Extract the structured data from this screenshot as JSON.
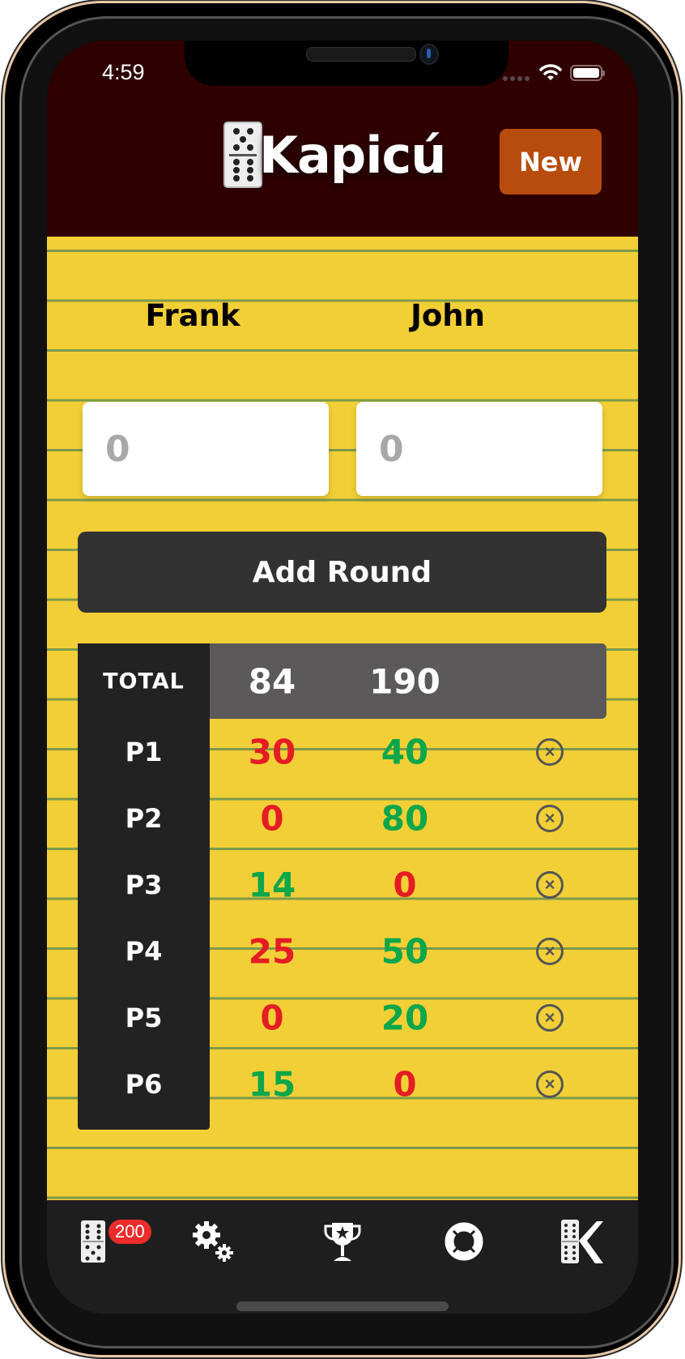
{
  "status_bar": {
    "time": "4:59"
  },
  "header": {
    "app_name": "Kapicú",
    "new_button": "New"
  },
  "players": [
    {
      "name": "Frank",
      "input_placeholder": "0"
    },
    {
      "name": "John",
      "input_placeholder": "0"
    }
  ],
  "add_round_label": "Add Round",
  "scoreboard": {
    "total_label": "TOTAL",
    "totals": [
      "84",
      "190"
    ],
    "rounds": [
      {
        "label": "P1",
        "scores": [
          {
            "value": "30",
            "status": "lose"
          },
          {
            "value": "40",
            "status": "win"
          }
        ]
      },
      {
        "label": "P2",
        "scores": [
          {
            "value": "0",
            "status": "lose"
          },
          {
            "value": "80",
            "status": "win"
          }
        ]
      },
      {
        "label": "P3",
        "scores": [
          {
            "value": "14",
            "status": "win"
          },
          {
            "value": "0",
            "status": "lose"
          }
        ]
      },
      {
        "label": "P4",
        "scores": [
          {
            "value": "25",
            "status": "lose"
          },
          {
            "value": "50",
            "status": "win"
          }
        ]
      },
      {
        "label": "P5",
        "scores": [
          {
            "value": "0",
            "status": "lose"
          },
          {
            "value": "20",
            "status": "win"
          }
        ]
      },
      {
        "label": "P6",
        "scores": [
          {
            "value": "15",
            "status": "win"
          },
          {
            "value": "0",
            "status": "lose"
          }
        ]
      }
    ],
    "delete_icon": "circle-x-icon"
  },
  "tab_bar": {
    "items": [
      {
        "icon": "domino-icon",
        "badge": "200"
      },
      {
        "icon": "gears-icon"
      },
      {
        "icon": "trophy-icon"
      },
      {
        "icon": "lifebuoy-icon"
      },
      {
        "icon": "kapicu-logo-icon"
      }
    ]
  },
  "colors": {
    "header_bg": "#2f0000",
    "paper": "#f2cf36",
    "new_button": "#b84c0d",
    "win": "#0ca64b",
    "lose": "#e51c23",
    "badge": "#ec2b2b"
  }
}
